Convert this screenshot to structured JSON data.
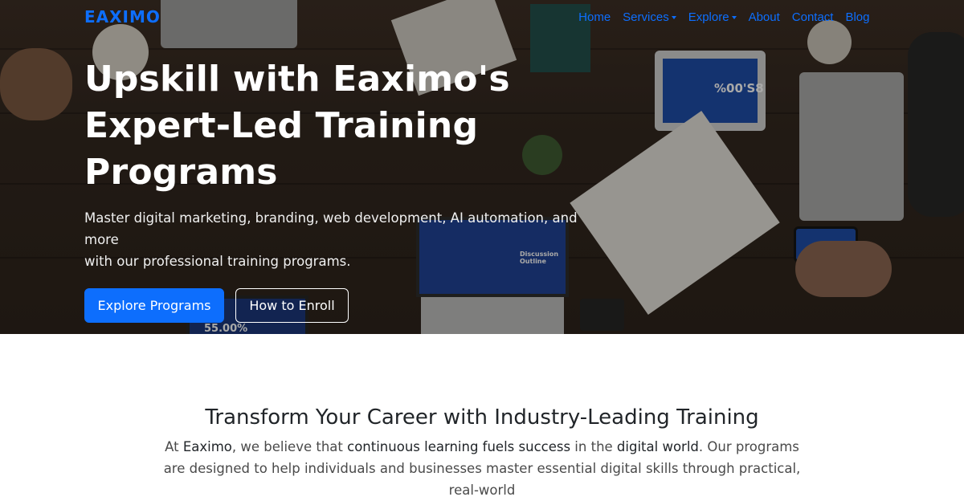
{
  "brand": {
    "name": "EAXIMO",
    "color": "#0d6efd"
  },
  "nav": {
    "items": [
      {
        "label": "Home",
        "dropdown": false
      },
      {
        "label": "Services",
        "dropdown": true
      },
      {
        "label": "Explore",
        "dropdown": true
      },
      {
        "label": "About",
        "dropdown": false
      },
      {
        "label": "Contact",
        "dropdown": false
      },
      {
        "label": "Blog",
        "dropdown": false
      }
    ]
  },
  "hero": {
    "title_line1": "Upskill with Eaximo's",
    "title_line2": "Expert-Led Training",
    "title_line3": "Programs",
    "lead_line1": "Master digital marketing, branding, web development, AI automation, and more",
    "lead_line2": "with our professional training programs.",
    "primary_button": "Explore Programs",
    "secondary_button": "How to Enroll",
    "accent": "#0d6efd",
    "laptop_screen_text": "Discussion Outline",
    "tablet_screen_text": "%00'S8",
    "bottom_screen_text": "55.00%"
  },
  "intro": {
    "title": "Transform Your Career with Industry-Leading Training",
    "text_part1": "At ",
    "text_strong1": "Eaximo",
    "text_part2": ", we believe that ",
    "text_strong2": "continuous learning fuels success",
    "text_part3": " in the ",
    "text_strong3": "digital world",
    "text_part4": ". Our programs are designed to help individuals and businesses master essential digital skills through practical, real-world"
  }
}
